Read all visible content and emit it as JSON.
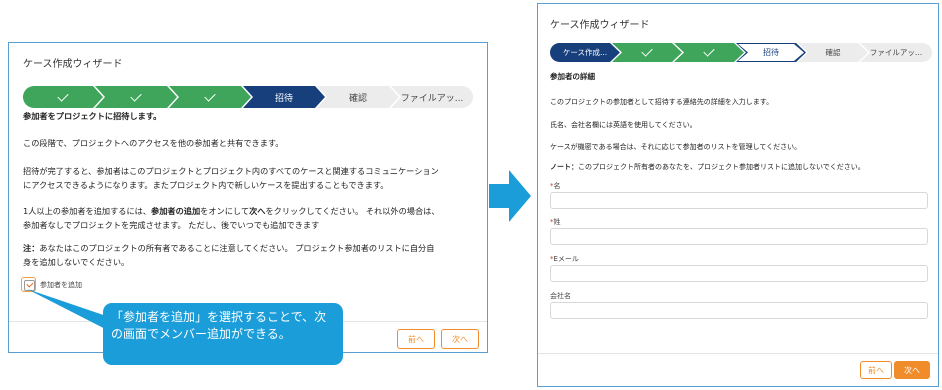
{
  "left": {
    "title": "ケース作成ウィザード",
    "steps": [
      "",
      "",
      "",
      "招待",
      "確認",
      "ファイルアッ..."
    ],
    "heading": "参加者をプロジェクトに招待します。",
    "p1": "この段階で、プロジェクトへのアクセスを他の参加者と共有できます。",
    "p2a": "招待が完了すると、参加者はこのプロジェクトとプロジェクト内のすべてのケースと関連するコミュニケーション",
    "p2b": "にアクセスできるようになります。またプロジェクト内で新しいケースを提出することもできます。",
    "p3a_1": "1人以上の参加者を追加するには、",
    "p3a_2": "参加者の追加",
    "p3a_3": "をオンにして",
    "p3a_4": "次へ",
    "p3a_5": "をクリックしてください。 それ以外の場合は、",
    "p3b": "参加者なしでプロジェクトを完成させます。 ただし、後でいつでも追加できます",
    "note_label": "注：",
    "note_a": "あなたはこのプロジェクトの所有者であることに注意してください。 プロジェクト参加者のリストに自分自",
    "note_b": "身を追加しないでください。",
    "checkbox_label": "参加者を追加",
    "prev": "前へ",
    "next": "次へ"
  },
  "callout": "「参加者を追加」を選択することで、次の画面でメンバー追加ができる。",
  "right": {
    "title": "ケース作成ウィザード",
    "steps": [
      "ケース作成...",
      "",
      "",
      "招待",
      "確認",
      "ファイルアッ..."
    ],
    "section": "参加者の詳細",
    "p1": "このプロジェクトの参加者として招待する連絡先の詳細を入力します。",
    "p2": "氏名、会社名欄には英語を使用してください。",
    "p3": "ケースが機密である場合は、それに応じて参加者のリストを管理してください。",
    "note_label": "ノート：",
    "note": "このプロジェクト所有者のあなたを、プロジェクト参加者リストに追加しないでください。",
    "req_mark": "*",
    "field1": "名",
    "field2": "姓",
    "field3": "Eメール",
    "field4": "会社名",
    "prev": "前へ",
    "next": "次へ"
  }
}
